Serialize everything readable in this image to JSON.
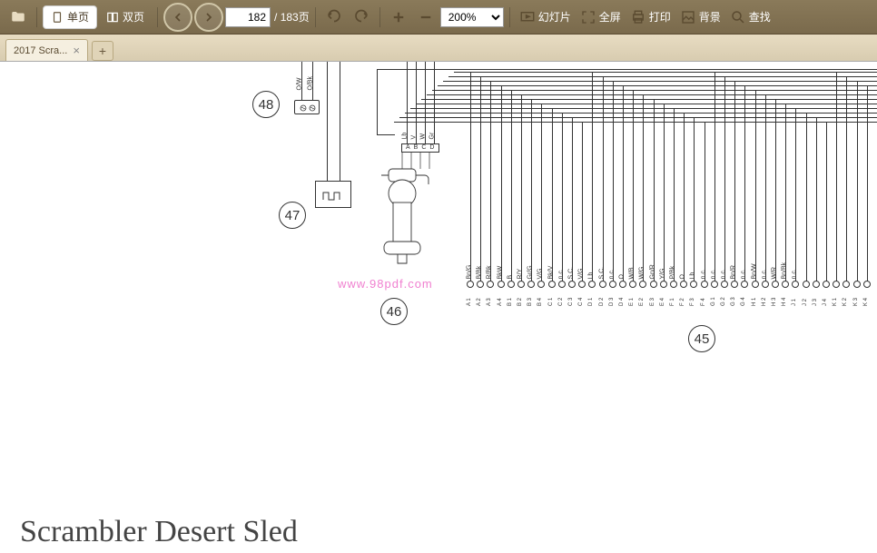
{
  "toolbar": {
    "single_page": "单页",
    "double_page": "双页",
    "page_current": "182",
    "page_total": "/ 183页",
    "zoom_value": "200%",
    "slideshow": "幻灯片",
    "fullscreen": "全屏",
    "print": "打印",
    "background": "背景",
    "find": "查找"
  },
  "tab": {
    "label": "2017 Scra...",
    "add": "+"
  },
  "diagram": {
    "callout_48": "48",
    "callout_47": "47",
    "callout_46": "46",
    "callout_45": "45",
    "title": "Scrambler Desert Sled",
    "watermark": "www.98pdf.com",
    "conn48_labels": [
      "O/W",
      "O/Bk"
    ],
    "conn46_labels_top": [
      "Lb",
      "V",
      "W",
      "Gr"
    ],
    "conn46_pins": [
      "A",
      "B",
      "C",
      "D"
    ],
    "bus_labels": [
      "Bn/G",
      "B/Bk",
      "R/Bk",
      "BkW",
      "B",
      "R/Y",
      "Gr/G",
      "V/G",
      "Bk/V",
      "n.c.",
      "S.C.",
      "V/G",
      "Lb",
      "S.C.",
      "n.c.",
      "O",
      "W/B",
      "W/G",
      "Gn/R",
      "Y/G",
      "P/Bk",
      "O",
      "Lb",
      "n.c.",
      "n.c.",
      "n.c.",
      "Bn/R",
      "n.c.",
      "Bn/W",
      "n.c.",
      "W/R",
      "Bn/Bk",
      "n.c."
    ],
    "bus_ids": [
      "A 1",
      "A 2",
      "A 3",
      "A 4",
      "B 1",
      "B 2",
      "B 3",
      "B 4",
      "C 1",
      "C 2",
      "C 3",
      "C 4",
      "D 1",
      "D 2",
      "D 3",
      "D 4",
      "E 1",
      "E 2",
      "E 3",
      "E 4",
      "F 1",
      "F 2",
      "F 3",
      "F 4",
      "G 1",
      "G 2",
      "G 3",
      "G 4",
      "H 1",
      "H 2",
      "H 3",
      "H 4",
      "J 1",
      "J 2",
      "J 3",
      "J 4",
      "K 1",
      "K 2",
      "K 3",
      "K 4"
    ]
  }
}
